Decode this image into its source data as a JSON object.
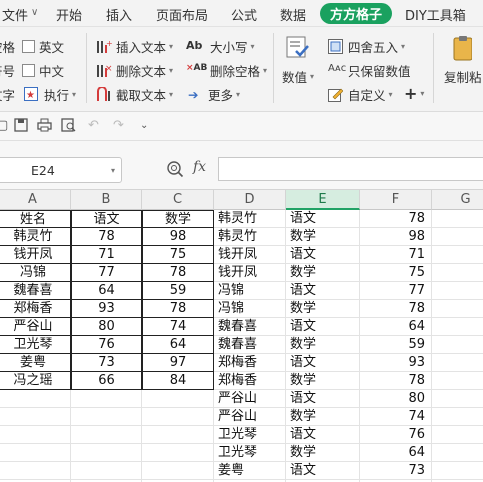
{
  "menubar": {
    "items": [
      "文件",
      "开始",
      "插入",
      "页面布局",
      "公式",
      "数据",
      "方方格子",
      "DIY工具箱"
    ],
    "active": "方方格子"
  },
  "ribbon": {
    "left_partial": [
      "空格",
      "符号",
      "文字"
    ],
    "checks": [
      "英文",
      "中文"
    ],
    "exec": "执行",
    "group1": [
      "插入文本",
      "删除文本",
      "截取文本"
    ],
    "group2": [
      "大小写",
      "删除空格",
      "更多"
    ],
    "numeric": "数值",
    "group3": [
      "四舍五入",
      "只保留数值",
      "自定义"
    ],
    "copy_paste": "复制粘"
  },
  "formula_bar": {
    "cell_ref": "E24",
    "fx": "fx",
    "value": ""
  },
  "columns": [
    "A",
    "B",
    "C",
    "D",
    "E",
    "F",
    "G"
  ],
  "selected_column": "E",
  "table_left": {
    "headers": [
      "姓名",
      "语文",
      "数学"
    ],
    "rows": [
      [
        "韩灵竹",
        "78",
        "98"
      ],
      [
        "钱开凤",
        "71",
        "75"
      ],
      [
        "冯锦",
        "77",
        "78"
      ],
      [
        "魏春喜",
        "64",
        "59"
      ],
      [
        "郑梅香",
        "93",
        "78"
      ],
      [
        "严谷山",
        "80",
        "74"
      ],
      [
        "卫光琴",
        "76",
        "64"
      ],
      [
        "姜粤",
        "73",
        "97"
      ],
      [
        "冯之瑶",
        "66",
        "84"
      ]
    ]
  },
  "table_right": {
    "rows": [
      [
        "韩灵竹",
        "语文",
        "78"
      ],
      [
        "韩灵竹",
        "数学",
        "98"
      ],
      [
        "钱开凤",
        "语文",
        "71"
      ],
      [
        "钱开凤",
        "数学",
        "75"
      ],
      [
        "冯锦",
        "语文",
        "77"
      ],
      [
        "冯锦",
        "数学",
        "78"
      ],
      [
        "魏春喜",
        "语文",
        "64"
      ],
      [
        "魏春喜",
        "数学",
        "59"
      ],
      [
        "郑梅香",
        "语文",
        "93"
      ],
      [
        "郑梅香",
        "数学",
        "78"
      ],
      [
        "严谷山",
        "语文",
        "80"
      ],
      [
        "严谷山",
        "数学",
        "74"
      ],
      [
        "卫光琴",
        "语文",
        "76"
      ],
      [
        "卫光琴",
        "数学",
        "64"
      ],
      [
        "姜粤",
        "语文",
        "73"
      ]
    ]
  },
  "colors": {
    "accent_green": "#1aa15f",
    "selected_col_bg": "#d6ede0"
  }
}
